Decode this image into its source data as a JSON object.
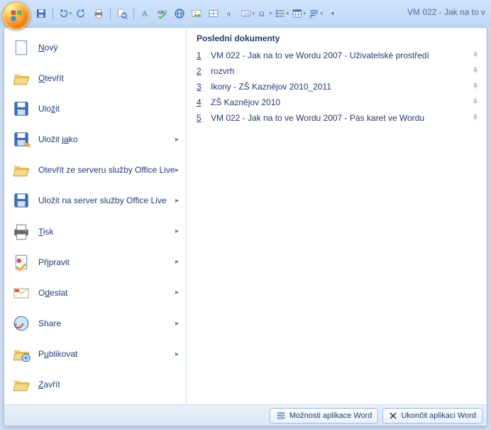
{
  "title": "VM 022 - Jak na to v",
  "qat_icons": [
    "save",
    "undo",
    "redo",
    "quickprint",
    "printpreview",
    "font-a",
    "spelling",
    "hyperlink",
    "image",
    "table-sm",
    "pi",
    "word-field",
    "omega",
    "bullets",
    "table",
    "para"
  ],
  "menu": {
    "items": [
      {
        "label_html": "<u>N</u>ový",
        "icon": "new",
        "arrow": false
      },
      {
        "label_html": "<u>O</u>tevřít",
        "icon": "open",
        "arrow": false
      },
      {
        "label_html": "Ulo<u>ž</u>it",
        "icon": "save",
        "arrow": false
      },
      {
        "label_html": "Uložit j<u>a</u>ko",
        "icon": "saveas",
        "arrow": true
      },
      {
        "label_html": "Otevřít ze serveru služby Office Live",
        "icon": "open-live",
        "arrow": true
      },
      {
        "label_html": "Uložit na server služby Office Live",
        "icon": "save-live",
        "arrow": true
      },
      {
        "label_html": "<u>T</u>isk",
        "icon": "print",
        "arrow": true
      },
      {
        "label_html": "Př<u>i</u>pravit",
        "icon": "prepare",
        "arrow": true
      },
      {
        "label_html": "O<u>d</u>eslat",
        "icon": "send",
        "arrow": true
      },
      {
        "label_html": "Share",
        "icon": "share",
        "arrow": true
      },
      {
        "label_html": "P<u>u</u>blikovat",
        "icon": "publish",
        "arrow": true
      },
      {
        "label_html": "<u>Z</u>avřít",
        "icon": "close-doc",
        "arrow": false
      }
    ]
  },
  "recent": {
    "heading": "Poslední dokumenty",
    "docs": [
      {
        "n": "1",
        "name": "VM 022 - Jak na to ve Wordu 2007 - Uživatelské prostředí"
      },
      {
        "n": "2",
        "name": "rozvrh"
      },
      {
        "n": "3",
        "name": "Ikony - ZŠ Kaznějov 2010_2011"
      },
      {
        "n": "4",
        "name": "ZŠ Kaznějov 2010"
      },
      {
        "n": "5",
        "name": "VM 022 - Jak na to ve Wordu 2007 - Pás karet ve Wordu"
      }
    ]
  },
  "footer": {
    "options": "Možnosti aplikace Word",
    "exit": "Ukončit aplikaci Word"
  }
}
